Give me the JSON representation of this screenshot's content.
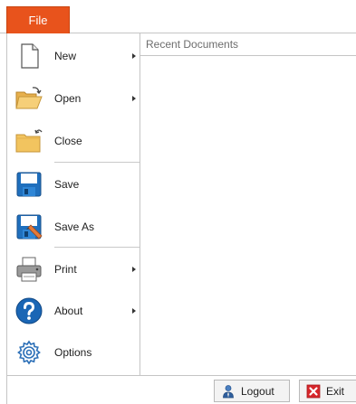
{
  "file_tab": {
    "label": "File"
  },
  "menu": {
    "items": [
      {
        "key": "new",
        "label": "New",
        "has_submenu": true
      },
      {
        "key": "open",
        "label": "Open",
        "has_submenu": true
      },
      {
        "key": "close",
        "label": "Close",
        "has_submenu": false
      },
      {
        "key": "save",
        "label": "Save",
        "has_submenu": false
      },
      {
        "key": "save_as",
        "label": "Save As",
        "has_submenu": false
      },
      {
        "key": "print",
        "label": "Print",
        "has_submenu": true
      },
      {
        "key": "about",
        "label": "About",
        "has_submenu": true
      },
      {
        "key": "options",
        "label": "Options",
        "has_submenu": false
      }
    ],
    "icons": [
      "new-document-icon",
      "open-folder-icon",
      "close-folder-icon",
      "save-disk-icon",
      "save-as-disk-icon",
      "printer-icon",
      "help-question-icon",
      "gear-options-icon"
    ]
  },
  "recent": {
    "header": "Recent Documents"
  },
  "bottom": {
    "logout_label": "Logout",
    "exit_label": "Exit"
  },
  "colors": {
    "file_tab": "#e8531c",
    "accent_blue": "#1f6fbd",
    "exit_red": "#d7262b"
  }
}
